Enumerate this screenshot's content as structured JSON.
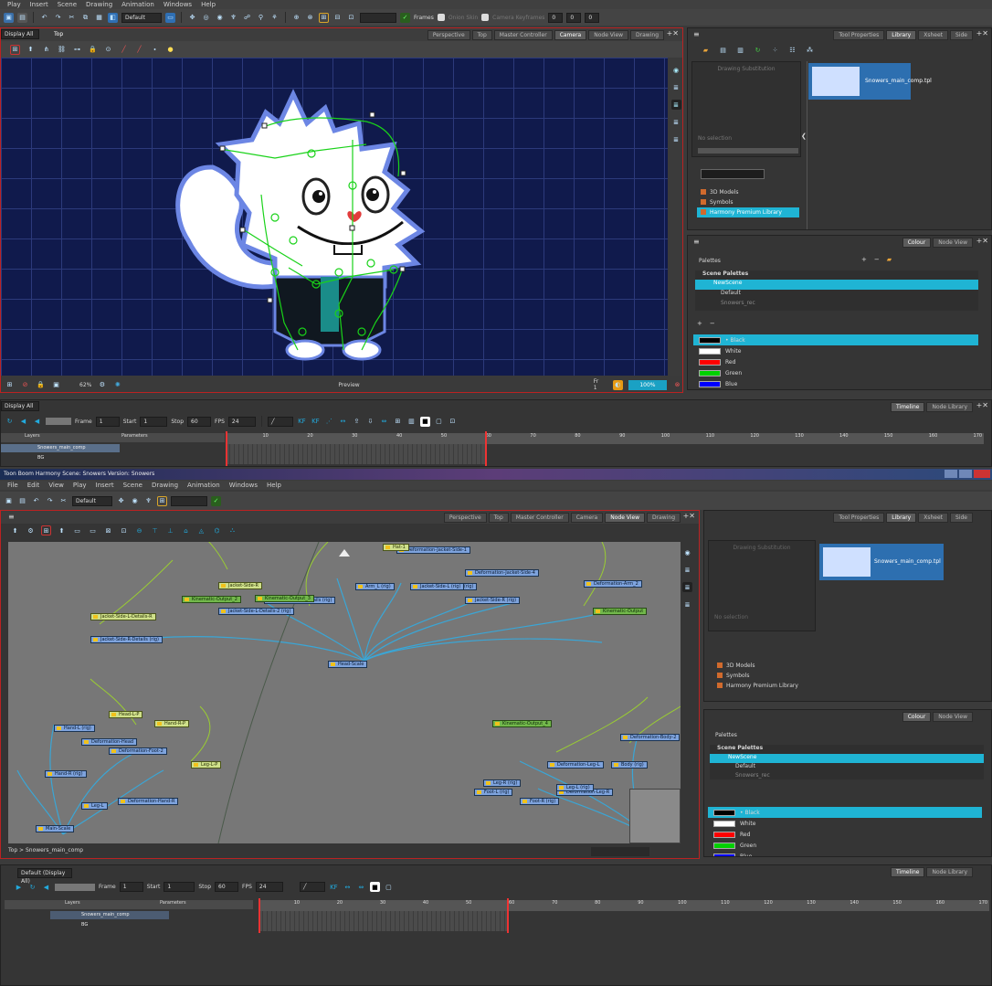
{
  "top": {
    "menu": [
      "Play",
      "Insert",
      "Scene",
      "Drawing",
      "Animation",
      "Windows",
      "Help"
    ],
    "toolbar": {
      "preset": "Default",
      "frames_label": "Frames",
      "values": [
        "0",
        "0",
        "0"
      ],
      "checks": [
        "Onion Skin",
        "Camera Keyframes"
      ]
    },
    "viewport": {
      "view_select": "Display All",
      "breadcrumb": "Top",
      "tabs": [
        "Perspective",
        "Top",
        "Master Controller",
        "Camera",
        "Node View",
        "Drawing"
      ],
      "active_tab": "Camera",
      "status": {
        "zoom": "62%",
        "preview": "Preview",
        "frame": "Fr 1",
        "percent": "100%"
      }
    },
    "library": {
      "tabs": [
        "Tool Properties",
        "Library",
        "Xsheet",
        "Side"
      ],
      "active_tab": "Library",
      "drawing_substitution": "Drawing Substitution",
      "no_selection": "No selection",
      "template_name": "Snowers_main_comp.tpl",
      "tree": [
        "3D Models",
        "Symbols",
        "Harmony Premium Library"
      ],
      "selected": "Harmony Premium Library"
    },
    "colour": {
      "tabs": [
        "Colour",
        "Node View"
      ],
      "active_tab": "Colour",
      "palettes_label": "Palettes",
      "scene_palettes_label": "Scene Palettes",
      "palettes": [
        "NewScene",
        "Default",
        "Snowers_rec"
      ],
      "selected_palette": "NewScene",
      "colors": [
        {
          "name": "Black",
          "hex": "#000000"
        },
        {
          "name": "White",
          "hex": "#ffffff"
        },
        {
          "name": "Red",
          "hex": "#ff0000"
        },
        {
          "name": "Green",
          "hex": "#00d000"
        },
        {
          "name": "Blue",
          "hex": "#0000ff"
        }
      ],
      "selected_color": "Black"
    },
    "timeline": {
      "view_select": "Display All",
      "tabs": [
        "Timeline",
        "Node Library"
      ],
      "active_tab": "Timeline",
      "frame_label": "Frame",
      "frame": "1",
      "start_label": "Start",
      "start": "1",
      "stop_label": "Stop",
      "stop": "60",
      "fps_label": "FPS",
      "fps": "24",
      "layers_label": "Layers",
      "params_label": "Parameters",
      "layers": [
        "Snowers_main_comp",
        "BG"
      ],
      "ruler": [
        "10",
        "20",
        "30",
        "40",
        "50",
        "60",
        "70",
        "80",
        "90",
        "100",
        "110",
        "120",
        "130",
        "140",
        "150",
        "160",
        "170"
      ]
    }
  },
  "bottom": {
    "titlebar": "Toon Boom Harmony Scene: Snowers Version: Snowers",
    "menu": [
      "File",
      "Edit",
      "View",
      "Play",
      "Insert",
      "Scene",
      "Drawing",
      "Animation",
      "Windows",
      "Help"
    ],
    "nodeview": {
      "tabs": [
        "Perspective",
        "Top",
        "Master Controller",
        "Camera",
        "Node View",
        "Drawing"
      ],
      "active_tab": "Node View",
      "breadcrumb": "Top > Snowers_main_comp",
      "nodes_blue": [
        "Deformation-Jacket-Side-1",
        "Deformation-Jacket-Side-4",
        "Arm_L (rig)",
        "Arm_R (rig)",
        "Jacket-Side-R (rig)",
        "Jacket-Side-L (rig)",
        "Jacket-Side-L-Details (rig)",
        "Jacket-Side-R-Details (rig)",
        "Jacket-Side-L-Details-2 (rig)",
        "Head-Scale",
        "Deformation-Arm_2",
        "Deformation-Head",
        "Deformation-Foot-2",
        "Deformation-Leg-L",
        "Deformation-Leg-R",
        "Deformation-Body-2",
        "Foot-L (rig)",
        "Foot-R (rig)",
        "Leg-L (rig)",
        "Leg-R (rig)",
        "Body (rig)",
        "Hand-L (rig)",
        "Hand-R (rig)",
        "Deformation-Hand-R",
        "Leg-L",
        "Main-Scale"
      ],
      "nodes_green": [
        "Kinematic-Output_2",
        "Kinematic-Output_3",
        "Kinematic-Output_4",
        "Kinematic-Output"
      ],
      "nodes_yellow": [
        "Jacket-Side-L-Details-R",
        "Jacket-Side-R",
        "Head-L-P",
        "Hand-R-P",
        "Leg-L-P",
        "Hat-1"
      ]
    },
    "library": {
      "tabs": [
        "Tool Properties",
        "Library",
        "Xsheet",
        "Side"
      ],
      "template_name": "Snowers_main_comp.tpl",
      "drawing_substitution": "Drawing Substitution",
      "no_selection": "No selection",
      "tree": [
        "3D Models",
        "Symbols",
        "Harmony Premium Library"
      ]
    },
    "colour": {
      "tabs": [
        "Colour",
        "Node View"
      ],
      "palettes_label": "Palettes",
      "scene_palettes_label": "Scene Palettes",
      "palettes": [
        "NewScene",
        "Default",
        "Snowers_rec"
      ],
      "colors": [
        {
          "name": "Black",
          "hex": "#000000"
        },
        {
          "name": "White",
          "hex": "#ffffff"
        },
        {
          "name": "Red",
          "hex": "#ff0000"
        },
        {
          "name": "Green",
          "hex": "#00d000"
        },
        {
          "name": "Blue",
          "hex": "#0000ff"
        }
      ]
    },
    "timeline": {
      "view_select": "Default (Display All)",
      "tabs": [
        "Timeline",
        "Node Library"
      ],
      "frame_label": "Frame",
      "frame": "1",
      "start_label": "Start",
      "start": "1",
      "stop_label": "Stop",
      "stop": "60",
      "fps_label": "FPS",
      "fps": "24",
      "layers_label": "Layers",
      "params_label": "Parameters",
      "layers": [
        "Snowers_main_comp",
        "BG"
      ],
      "ruler": [
        "10",
        "20",
        "30",
        "40",
        "50",
        "60",
        "70",
        "80",
        "90",
        "100",
        "110",
        "120",
        "130",
        "140",
        "150",
        "160",
        "170"
      ]
    }
  }
}
